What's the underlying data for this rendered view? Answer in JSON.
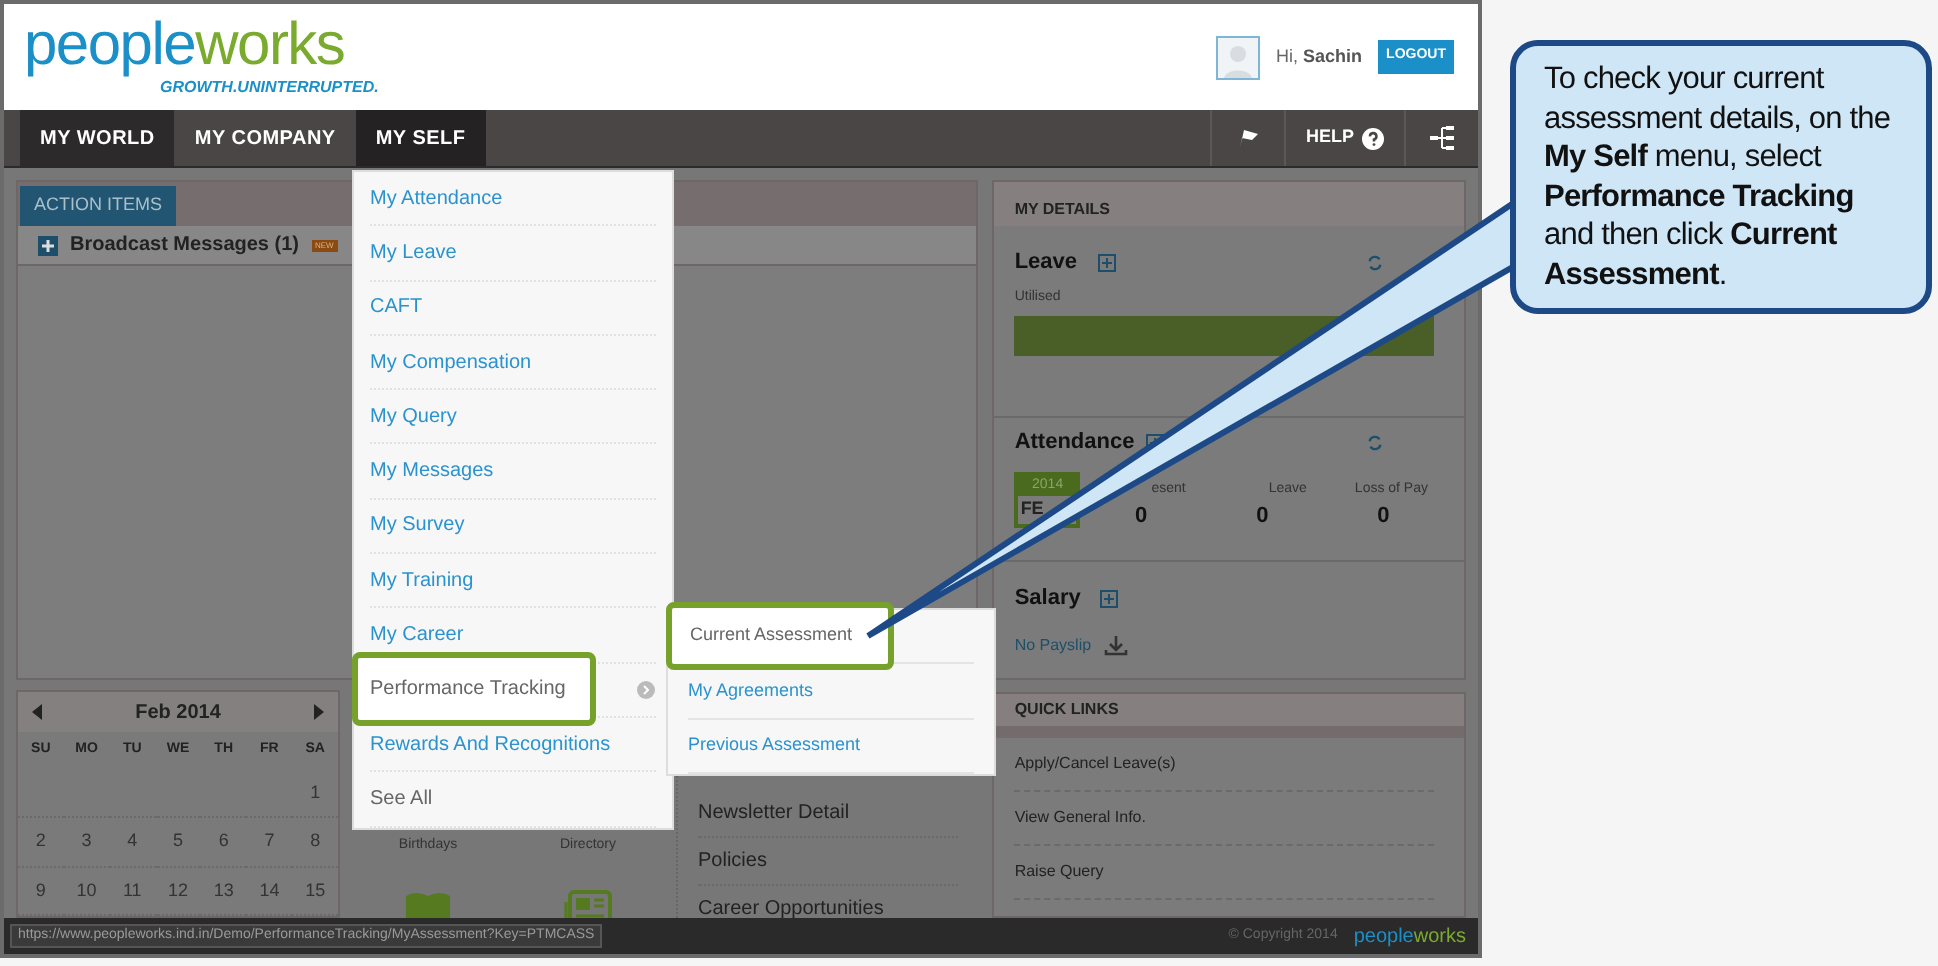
{
  "logo": {
    "part1": "people",
    "part2": "works",
    "tagline": "GROWTH.UNINTERRUPTED."
  },
  "user": {
    "greeting": "Hi,",
    "name": "Sachin",
    "logout": "LOGOUT"
  },
  "nav": {
    "tabs": [
      {
        "label": "MY WORLD",
        "selected": true,
        "expanded": false
      },
      {
        "label": "MY COMPANY",
        "selected": false,
        "expanded": false
      },
      {
        "label": "MY SELF",
        "selected": false,
        "expanded": true
      }
    ],
    "help": "HELP"
  },
  "action_items": {
    "tab": "ACTION ITEMS",
    "broadcast": "Broadcast Messages (1)",
    "badge": "NEW"
  },
  "calendar": {
    "month": "Feb 2014",
    "weekdays": [
      "SU",
      "MO",
      "TU",
      "WE",
      "TH",
      "FR",
      "SA"
    ],
    "weeks": [
      [
        "1"
      ],
      [
        "2",
        "3",
        "4",
        "5",
        "6",
        "7",
        "8"
      ],
      [
        "9",
        "10",
        "11",
        "12",
        "13",
        "14",
        "15"
      ]
    ]
  },
  "shortcuts": [
    {
      "label": "Birthdays",
      "kind": "book"
    },
    {
      "label": "Directory",
      "kind": "directory"
    }
  ],
  "links": [
    "Newsletter Detail",
    "Policies",
    "Career Opportunities"
  ],
  "my_details": {
    "title": "MY DETAILS",
    "leave": {
      "title": "Leave",
      "caption": "Utilised"
    },
    "attendance": {
      "title": "Attendance",
      "year": "2014",
      "month": "FE",
      "stats": [
        {
          "label": "esent",
          "value": "0"
        },
        {
          "label": "Leave",
          "value": "0"
        },
        {
          "label": "Loss of Pay",
          "value": "0"
        }
      ]
    },
    "salary": {
      "title": "Salary",
      "payslip": "No Payslip"
    }
  },
  "quick_links": {
    "title": "QUICK LINKS",
    "items": [
      "Apply/Cancel Leave(s)",
      "View General Info.",
      "Raise Query"
    ]
  },
  "menu": [
    {
      "label": "My Attendance",
      "kind": "link",
      "highlighted": false
    },
    {
      "label": "My Leave",
      "kind": "link",
      "highlighted": false
    },
    {
      "label": "CAFT",
      "kind": "link",
      "highlighted": false
    },
    {
      "label": "My Compensation",
      "kind": "link",
      "highlighted": false
    },
    {
      "label": "My Query",
      "kind": "link",
      "highlighted": false
    },
    {
      "label": "My Messages",
      "kind": "link",
      "highlighted": false
    },
    {
      "label": "My Survey",
      "kind": "link",
      "highlighted": false
    },
    {
      "label": "My Training",
      "kind": "link",
      "highlighted": false
    },
    {
      "label": "My Career",
      "kind": "link",
      "highlighted": false
    },
    {
      "label": "Performance Tracking",
      "kind": "submenu",
      "highlighted": true
    },
    {
      "label": "Rewards And Recognitions",
      "kind": "link",
      "highlighted": false
    },
    {
      "label": "See All",
      "kind": "more",
      "highlighted": false
    }
  ],
  "submenu": [
    {
      "label": "Current Assessment",
      "highlighted": true
    },
    {
      "label": "My Agreements",
      "highlighted": false
    },
    {
      "label": "Previous Assessment",
      "highlighted": false
    }
  ],
  "status_url": "https://www.peopleworks.ind.in/Demo/PerformanceTracking/MyAssessment?Key=PTMCASS",
  "footer": {
    "copyright": "© Copyright 2014",
    "logo_part1": "people",
    "logo_part2": "works"
  },
  "callout": "To check your current assessment details, on the **My Self** menu, select **Performance Tracking** and then click **Current Assessment**."
}
